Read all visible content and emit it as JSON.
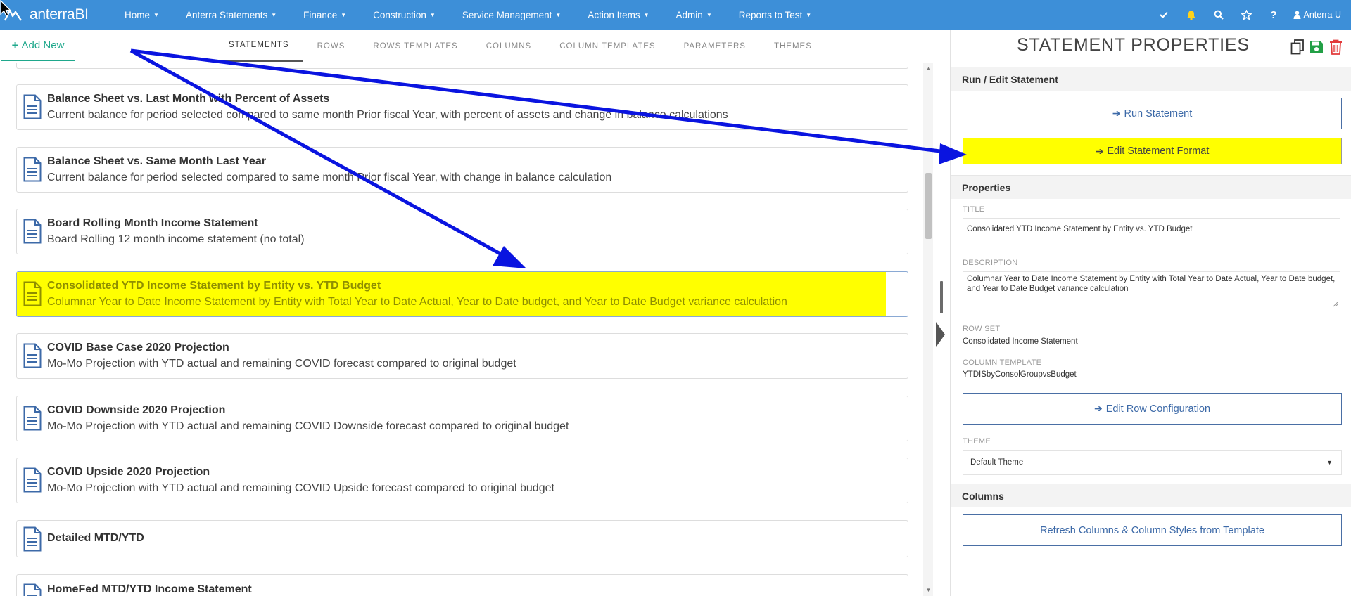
{
  "brand": {
    "name": "anterraBI"
  },
  "nav": {
    "menus": [
      {
        "label": "Home"
      },
      {
        "label": "Anterra Statements"
      },
      {
        "label": "Finance"
      },
      {
        "label": "Construction"
      },
      {
        "label": "Service Management"
      },
      {
        "label": "Action Items"
      },
      {
        "label": "Admin"
      },
      {
        "label": "Reports to Test"
      }
    ],
    "user": "Anterra U",
    "icons": [
      "check-icon",
      "bell-icon",
      "search-icon",
      "star-icon",
      "help-icon",
      "user-icon"
    ]
  },
  "toolbar": {
    "add_new_label": "Add New"
  },
  "tabs": [
    {
      "label": "STATEMENTS",
      "active": true
    },
    {
      "label": "ROWS"
    },
    {
      "label": "ROWS TEMPLATES"
    },
    {
      "label": "COLUMNS"
    },
    {
      "label": "COLUMN TEMPLATES"
    },
    {
      "label": "PARAMETERS"
    },
    {
      "label": "THEMES"
    }
  ],
  "statements": [
    {
      "title": "Balance Sheet vs. Last Month with Percent of Assets",
      "description": "Current balance for period selected compared to same month Prior fiscal Year, with percent of assets and change in balance calculations"
    },
    {
      "title": "Balance Sheet vs. Same Month Last Year",
      "description": "Current balance for period selected compared to same month Prior fiscal Year, with change in balance calculation"
    },
    {
      "title": "Board Rolling Month Income Statement",
      "description": "Board Rolling 12 month income statement (no total)"
    },
    {
      "title": "Consolidated YTD Income Statement by Entity vs. YTD Budget",
      "description": "Columnar Year to Date Income Statement by Entity with Total Year to Date Actual, Year to Date budget, and Year to Date Budget variance calculation",
      "selected": true
    },
    {
      "title": "COVID Base Case 2020 Projection",
      "description": "Mo-Mo Projection with YTD actual and remaining COVID forecast compared to original budget"
    },
    {
      "title": "COVID Downside 2020 Projection",
      "description": "Mo-Mo Projection with YTD actual and remaining COVID Downside forecast compared to original budget"
    },
    {
      "title": "COVID Upside 2020 Projection",
      "description": "Mo-Mo Projection with YTD actual and remaining COVID Upside forecast compared to original budget"
    },
    {
      "title": "Detailed MTD/YTD",
      "description": ""
    },
    {
      "title": "HomeFed MTD/YTD Income Statement",
      "description": ""
    }
  ],
  "panel": {
    "title": "STATEMENT PROPERTIES",
    "run_section": "Run / Edit Statement",
    "run_button": "Run Statement",
    "edit_format_button": "Edit Statement Format",
    "properties_section": "Properties",
    "title_label": "TITLE",
    "title_value": "Consolidated YTD Income Statement by Entity vs. YTD Budget",
    "description_label": "DESCRIPTION",
    "description_value": "Columnar Year to Date Income Statement by Entity with Total Year to Date Actual, Year to Date budget, and Year to Date Budget variance calculation",
    "row_set_label": "ROW SET",
    "row_set_value": "Consolidated Income Statement",
    "column_template_label": "COLUMN TEMPLATE",
    "column_template_value": "YTDISbyConsolGroupvsBudget",
    "edit_row_button": "Edit Row Configuration",
    "theme_label": "THEME",
    "theme_value": "Default Theme",
    "columns_section": "Columns",
    "refresh_button": "Refresh Columns & Column Styles from Template"
  },
  "colors": {
    "nav_bg": "#3d8fd8",
    "highlight": "#ffff00",
    "annotation_arrow": "#0a14e0",
    "accent_green": "#1fa88c",
    "button_blue": "#3d6aa8"
  }
}
